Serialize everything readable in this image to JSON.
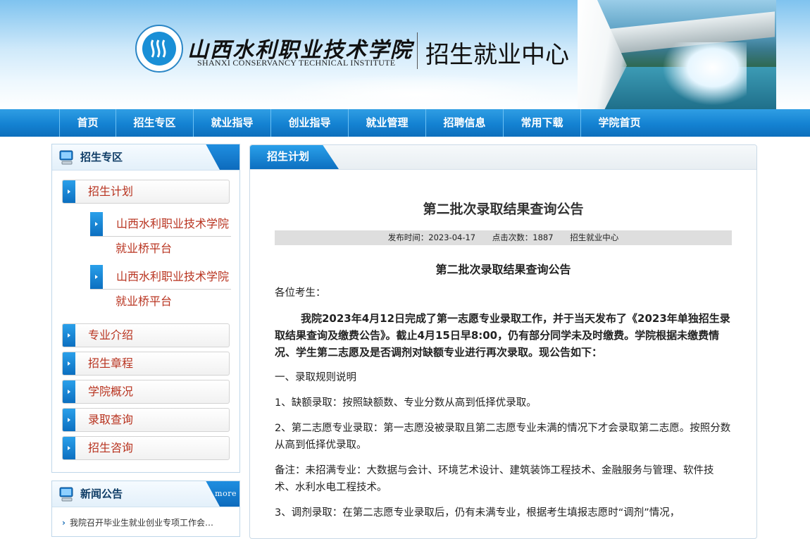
{
  "header": {
    "school_name_cn": "山西水利职业技术学院",
    "school_name_en": "SHANXI CONSERVANCY TECHNICAL INSTITUTE",
    "center_title": "招生就业中心"
  },
  "nav": {
    "items": [
      "首页",
      "招生专区",
      "就业指导",
      "创业指导",
      "就业管理",
      "招聘信息",
      "常用下载",
      "学院首页"
    ]
  },
  "sidebar": {
    "title": "招生专区",
    "items": [
      {
        "label": "招生计划"
      },
      {
        "label": "专业介绍"
      },
      {
        "label": "招生章程"
      },
      {
        "label": "学院概况"
      },
      {
        "label": "录取查询"
      },
      {
        "label": "招生咨询"
      }
    ],
    "sub_items": [
      {
        "line1": "山西水利职业技术学院",
        "line2": "就业桥平台"
      },
      {
        "line1": "山西水利职业技术学院",
        "line2": "就业桥平台"
      }
    ]
  },
  "news": {
    "title": "新闻公告",
    "more": "more",
    "items": [
      "我院召开毕业生就业创业专项工作会…"
    ]
  },
  "main": {
    "tab_label": "招生计划",
    "title": "第二批次录取结果查询公告",
    "meta": {
      "date": "发布时间：2023-04-17",
      "clicks": "点击次数：1887",
      "source": "招生就业中心"
    },
    "subtitle": "第二批次录取结果查询公告",
    "greeting": "各位考生：",
    "intro": "我院2023年4月12日完成了第一志愿专业录取工作，并于当天发布了《2023年单独招生录取结果查询及缴费公告》。截止4月15日早8:00，仍有部分同学未及时缴费。学院根据未缴费情况、学生第二志愿及是否调剂对缺额专业进行再次录取。现公告如下：",
    "section1": "一、录取规则说明",
    "rule1": "1、缺额录取：按照缺额数、专业分数从高到低择优录取。",
    "rule2": "2、第二志愿专业录取：第一志愿没被录取且第二志愿专业未满的情况下才会录取第二志愿。按照分数从高到低择优录取。",
    "note": "备注：未招满专业：大数据与会计、环境艺术设计、建筑装饰工程技术、金融服务与管理、软件技术、水利水电工程技术。",
    "rule3": "3、调剂录取：在第二志愿专业录取后，仍有未满专业，根据考生填报志愿时“调剂”情况，"
  }
}
